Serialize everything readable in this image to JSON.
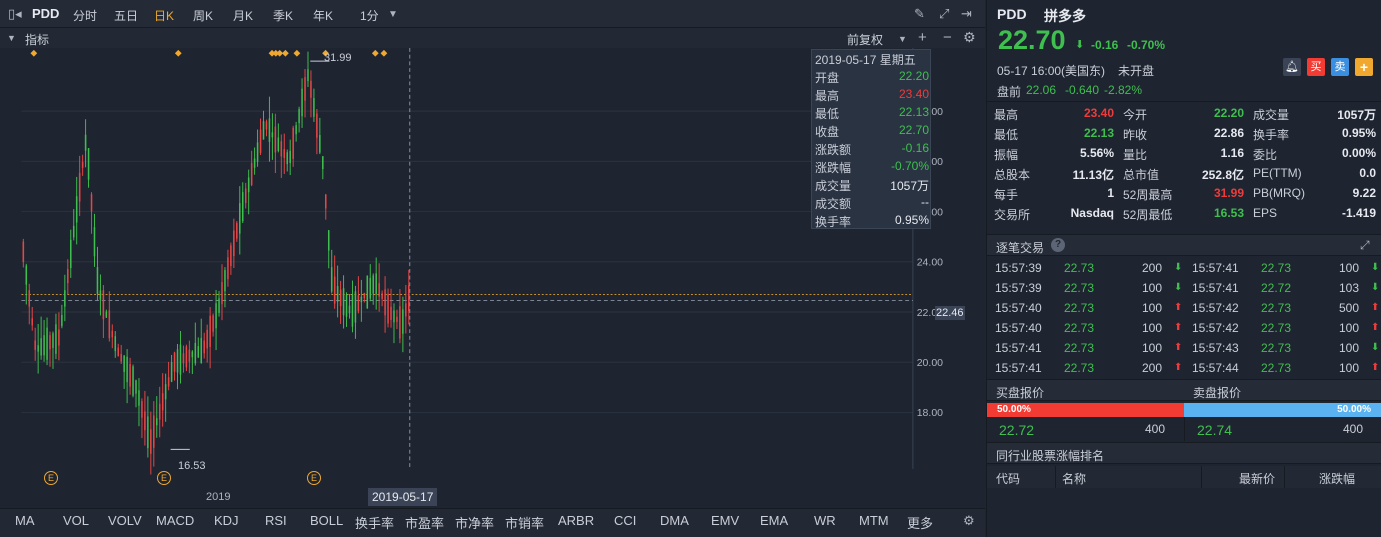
{
  "toolbar": {
    "symbol": "PDD",
    "tabs": [
      "分时",
      "五日",
      "日K",
      "周K",
      "月K",
      "季K",
      "年K",
      "1分"
    ],
    "active_tab": "日K"
  },
  "indicator_header": {
    "label": "指标",
    "adjust": "前复权"
  },
  "axis": {
    "y_labels": [
      "30.00",
      "28.00",
      "26.00",
      "24.00",
      "22.00",
      "20.00",
      "18.00"
    ],
    "current_price_label": "22.46",
    "year_label": "2019",
    "cursor_date": "2019-05-17",
    "high_marker": "31.99",
    "low_marker": "16.53",
    "event_marker": "E"
  },
  "infobox": {
    "date": "2019-05-17 星期五",
    "rows": [
      {
        "k": "开盘",
        "v": "22.20",
        "c": "green"
      },
      {
        "k": "最高",
        "v": "23.40",
        "c": "red"
      },
      {
        "k": "最低",
        "v": "22.13",
        "c": "green"
      },
      {
        "k": "收盘",
        "v": "22.70",
        "c": "green"
      },
      {
        "k": "涨跌额",
        "v": "-0.16",
        "c": "green"
      },
      {
        "k": "涨跌幅",
        "v": "-0.70%",
        "c": "green"
      },
      {
        "k": "成交量",
        "v": "1057万",
        "c": "white"
      },
      {
        "k": "成交额",
        "v": "--",
        "c": "white"
      },
      {
        "k": "换手率",
        "v": "0.95%",
        "c": "white"
      }
    ]
  },
  "bottom_indicators": [
    "MA",
    "VOL",
    "VOLV",
    "MACD",
    "KDJ",
    "RSI",
    "BOLL",
    "换手率",
    "市盈率",
    "市净率",
    "市销率",
    "ARBR",
    "CCI",
    "DMA",
    "EMV",
    "EMA",
    "WR",
    "MTM",
    "更多"
  ],
  "quote": {
    "symbol": "PDD",
    "name": "拼多多",
    "price": "22.70",
    "change": "-0.16",
    "change_pct": "-0.70%",
    "time": "05-17  16:00(美国东)",
    "status": "未开盘",
    "buy_label": "买",
    "sell_label": "卖",
    "add_label": "+",
    "premarket_label": "盘前",
    "premarket_price": "22.06",
    "premarket_change": "-0.640",
    "premarket_pct": "-2.82%"
  },
  "stats": [
    [
      {
        "k": "最高",
        "v": "23.40",
        "c": "red"
      },
      {
        "k": "今开",
        "v": "22.20",
        "c": "green"
      },
      {
        "k": "成交量",
        "v": "1057万",
        "c": "white"
      }
    ],
    [
      {
        "k": "最低",
        "v": "22.13",
        "c": "green"
      },
      {
        "k": "昨收",
        "v": "22.86",
        "c": "white"
      },
      {
        "k": "换手率",
        "v": "0.95%",
        "c": "white"
      }
    ],
    [
      {
        "k": "振幅",
        "v": "5.56%",
        "c": "white"
      },
      {
        "k": "量比",
        "v": "1.16",
        "c": "white"
      },
      {
        "k": "委比",
        "v": "0.00%",
        "c": "white"
      }
    ],
    [
      {
        "k": "总股本",
        "v": "11.13亿",
        "c": "white"
      },
      {
        "k": "总市值",
        "v": "252.8亿",
        "c": "white"
      },
      {
        "k": "PE(TTM)",
        "v": "0.0",
        "c": "white"
      }
    ],
    [
      {
        "k": "每手",
        "v": "1",
        "c": "white"
      },
      {
        "k": "52周最高",
        "v": "31.99",
        "c": "red"
      },
      {
        "k": "PB(MRQ)",
        "v": "9.22",
        "c": "white"
      }
    ],
    [
      {
        "k": "交易所",
        "v": "Nasdaq",
        "c": "white"
      },
      {
        "k": "52周最低",
        "v": "16.53",
        "c": "green"
      },
      {
        "k": "EPS",
        "v": "-1.419",
        "c": "white"
      }
    ]
  ],
  "ticks_title": "逐笔交易",
  "ticks_left": [
    {
      "t": "15:57:39",
      "p": "22.73",
      "q": "200",
      "d": "down"
    },
    {
      "t": "15:57:39",
      "p": "22.73",
      "q": "100",
      "d": "down"
    },
    {
      "t": "15:57:40",
      "p": "22.73",
      "q": "100",
      "d": "up"
    },
    {
      "t": "15:57:40",
      "p": "22.73",
      "q": "100",
      "d": "up"
    },
    {
      "t": "15:57:41",
      "p": "22.73",
      "q": "100",
      "d": "up"
    },
    {
      "t": "15:57:41",
      "p": "22.73",
      "q": "200",
      "d": "up"
    }
  ],
  "ticks_right": [
    {
      "t": "15:57:41",
      "p": "22.73",
      "q": "100",
      "d": "down"
    },
    {
      "t": "15:57:41",
      "p": "22.72",
      "q": "103",
      "d": "down"
    },
    {
      "t": "15:57:42",
      "p": "22.73",
      "q": "500",
      "d": "up"
    },
    {
      "t": "15:57:42",
      "p": "22.73",
      "q": "100",
      "d": "up"
    },
    {
      "t": "15:57:43",
      "p": "22.73",
      "q": "100",
      "d": "down"
    },
    {
      "t": "15:57:44",
      "p": "22.73",
      "q": "100",
      "d": "up"
    }
  ],
  "orderbook": {
    "bid_title": "买盘报价",
    "ask_title": "卖盘报价",
    "bid_pct": "50.00%",
    "ask_pct": "50.00%",
    "bid_price": "22.72",
    "bid_size": "400",
    "ask_price": "22.74",
    "ask_size": "400",
    "bid_color": "#f23b33",
    "ask_color": "#5ab3f0"
  },
  "peer": {
    "title": "同行业股票涨幅排名",
    "columns": [
      "代码",
      "名称",
      "最新价",
      "涨跌幅"
    ]
  }
}
